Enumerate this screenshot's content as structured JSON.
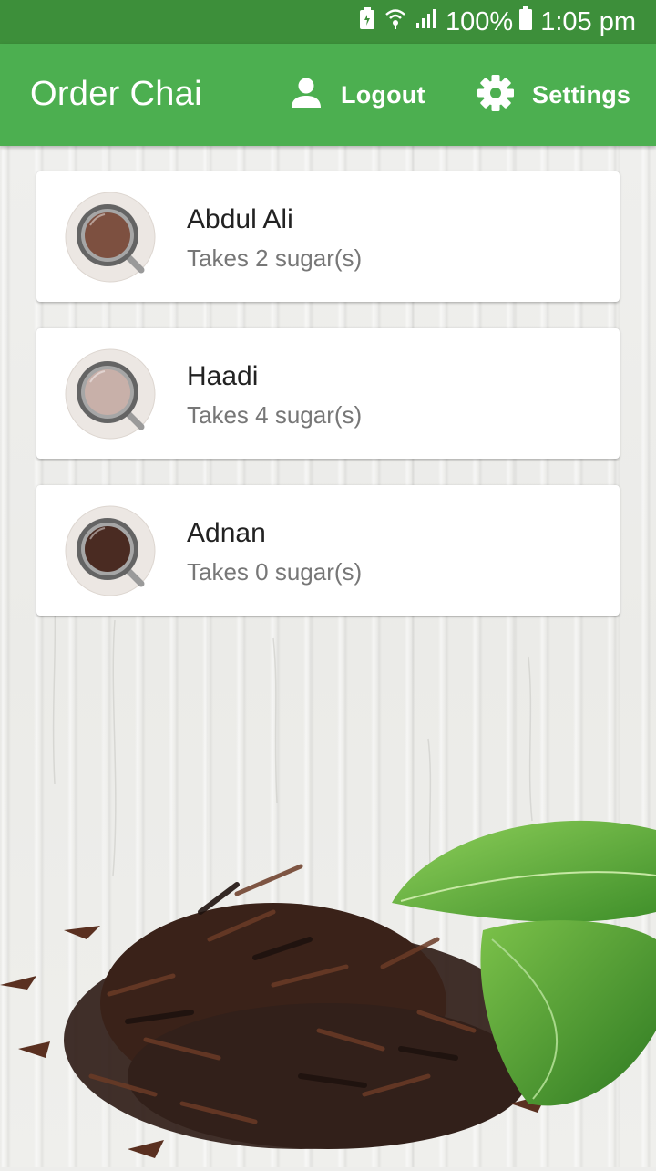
{
  "status_bar": {
    "battery": "100%",
    "time": "1:05 pm",
    "icons": [
      "battery-saver-icon",
      "wifi-icon",
      "signal-icon",
      "battery-icon"
    ]
  },
  "app_bar": {
    "title": "Order Chai",
    "logout_label": "Logout",
    "settings_label": "Settings",
    "color": "#4caf50",
    "status_color": "#3d8f3a"
  },
  "orders": [
    {
      "name": "Abdul Ali",
      "sugar_text": "Takes 2 sugar(s)",
      "tea_color": "#7d5040"
    },
    {
      "name": "Haadi",
      "sugar_text": "Takes 4 sugar(s)",
      "tea_color": "#c8b0a9"
    },
    {
      "name": "Adnan",
      "sugar_text": "Takes 0 sugar(s)",
      "tea_color": "#4a2b22"
    }
  ]
}
